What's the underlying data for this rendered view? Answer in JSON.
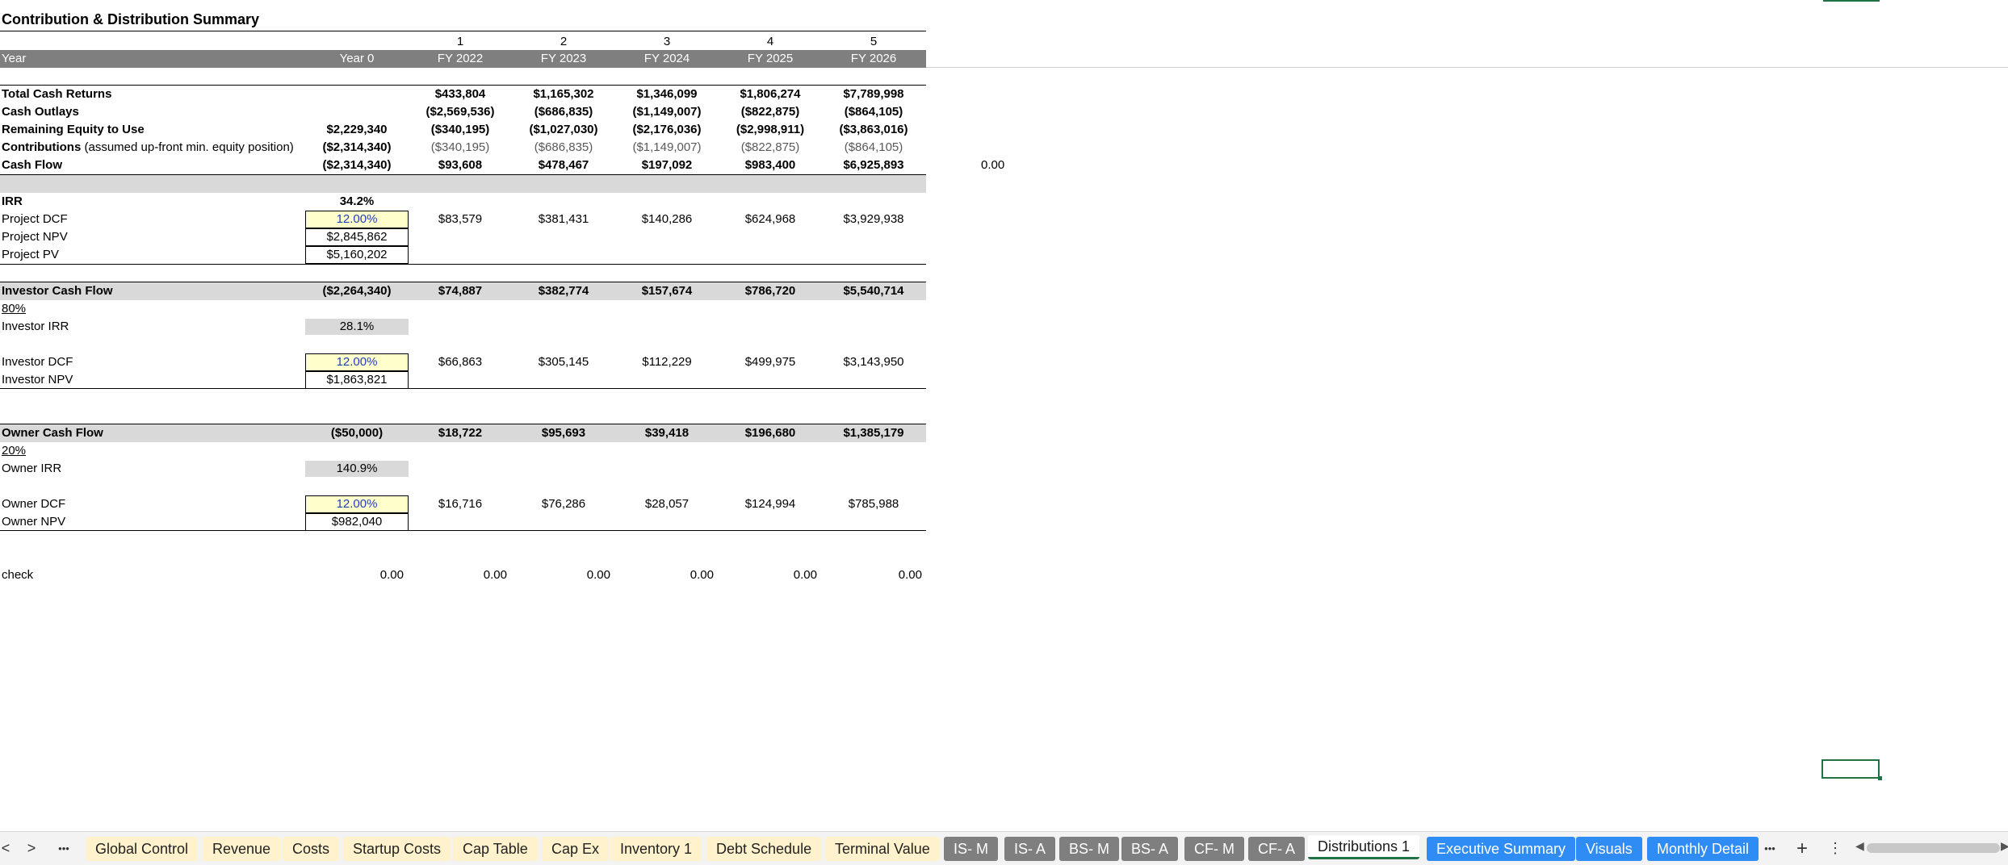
{
  "sheet": {
    "title": "Contribution & Distribution Summary",
    "period_numbers": [
      "1",
      "2",
      "3",
      "4",
      "5"
    ],
    "year_label": "Year",
    "year_headers": [
      "Year 0",
      "FY 2022",
      "FY 2023",
      "FY 2024",
      "FY 2025",
      "FY 2026"
    ],
    "total_cash_returns": {
      "label": "Total Cash Returns",
      "values": [
        "",
        "$433,804",
        "$1,165,302",
        "$1,346,099",
        "$1,806,274",
        "$7,789,998"
      ]
    },
    "cash_outlays": {
      "label": "Cash Outlays",
      "values": [
        "",
        "($2,569,536)",
        "($686,835)",
        "($1,149,007)",
        "($822,875)",
        "($864,105)"
      ]
    },
    "remaining_equity": {
      "label": "Remaining Equity to Use",
      "values": [
        "$2,229,340",
        "($340,195)",
        "($1,027,030)",
        "($2,176,036)",
        "($2,998,911)",
        "($3,863,016)"
      ]
    },
    "contributions": {
      "label": "Contributions",
      "note": "(assumed up-front min. equity position)",
      "values": [
        "($2,314,340)",
        "($340,195)",
        "($686,835)",
        "($1,149,007)",
        "($822,875)",
        "($864,105)"
      ]
    },
    "cash_flow": {
      "label": "Cash Flow",
      "values": [
        "($2,314,340)",
        "$93,608",
        "$478,467",
        "$197,092",
        "$983,400",
        "$6,925,893"
      ]
    },
    "cash_flow_side_value": "0.00",
    "irr": {
      "label": "IRR",
      "value": "34.2%"
    },
    "project_dcf": {
      "label": "Project DCF",
      "values": [
        "12.00%",
        "$83,579",
        "$381,431",
        "$140,286",
        "$624,968",
        "$3,929,938"
      ]
    },
    "project_npv": {
      "label": "Project NPV",
      "value": "$2,845,862"
    },
    "project_pv": {
      "label": "Project PV",
      "value": "$5,160,202"
    },
    "investor_cash_flow": {
      "label": "Investor Cash Flow",
      "values": [
        "($2,264,340)",
        "$74,887",
        "$382,774",
        "$157,674",
        "$786,720",
        "$5,540,714"
      ]
    },
    "investor_pct": "80%",
    "investor_irr": {
      "label": "Investor IRR",
      "value": "28.1%"
    },
    "investor_dcf": {
      "label": "Investor DCF",
      "values": [
        "12.00%",
        "$66,863",
        "$305,145",
        "$112,229",
        "$499,975",
        "$3,143,950"
      ]
    },
    "investor_npv": {
      "label": "Investor NPV",
      "value": "$1,863,821"
    },
    "owner_cash_flow": {
      "label": "Owner Cash Flow",
      "values": [
        "($50,000)",
        "$18,722",
        "$95,693",
        "$39,418",
        "$196,680",
        "$1,385,179"
      ]
    },
    "owner_pct": "20%",
    "owner_irr": {
      "label": "Owner IRR",
      "value": "140.9%"
    },
    "owner_dcf": {
      "label": "Owner DCF",
      "values": [
        "12.00%",
        "$16,716",
        "$76,286",
        "$28,057",
        "$124,994",
        "$785,988"
      ]
    },
    "owner_npv": {
      "label": "Owner NPV",
      "value": "$982,040"
    },
    "check": {
      "label": "check",
      "values": [
        "0.00",
        "0.00",
        "0.00",
        "0.00",
        "0.00",
        "0.00"
      ]
    }
  },
  "tabs": {
    "nav_prev": "<",
    "nav_next": ">",
    "more_left": "•••",
    "items": [
      "Global Control",
      "Revenue",
      "Costs",
      "Startup Costs",
      "Cap Table",
      "Cap Ex",
      "Inventory 1",
      "Debt Schedule",
      "Terminal Value",
      "IS- M",
      "IS- A",
      "BS- M",
      "BS- A",
      "CF- M",
      "CF- A",
      "Distributions 1",
      "Executive Summary",
      "Visuals",
      "Monthly Detail"
    ],
    "more_right": "•••",
    "add": "+",
    "options": "⋮"
  },
  "colors": {
    "year_bar": "#7f7f7f",
    "light_bar": "#d9d9d9",
    "input_yellow": "#ffffcc",
    "tab_cream": "#fff2cc",
    "tab_gray": "#7f7f7f",
    "tab_blue": "#2f8cf5",
    "selection_green": "#217346"
  }
}
